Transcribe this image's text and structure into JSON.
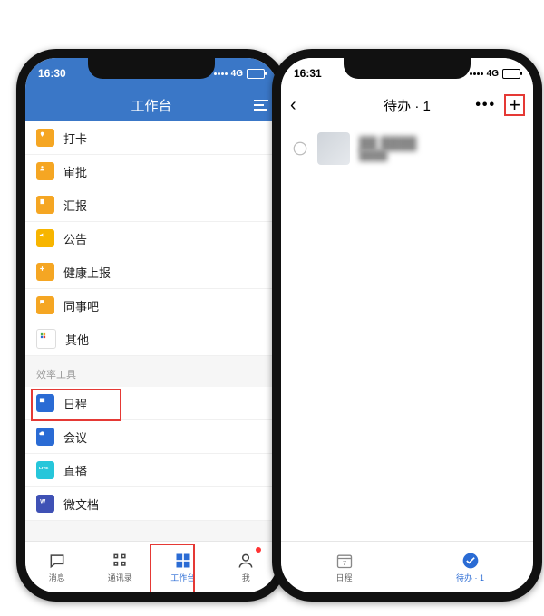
{
  "leftPhone": {
    "status": {
      "time": "16:30",
      "net": "4G"
    },
    "nav": {
      "title": "工作台"
    },
    "apps": [
      {
        "label": "打卡",
        "icon": "pin-icon",
        "color": "c-orange"
      },
      {
        "label": "审批",
        "icon": "person-icon",
        "color": "c-orange"
      },
      {
        "label": "汇报",
        "icon": "report-icon",
        "color": "c-orange"
      },
      {
        "label": "公告",
        "icon": "announce-icon",
        "color": "c-yellow"
      },
      {
        "label": "健康上报",
        "icon": "health-icon",
        "color": "c-orange"
      },
      {
        "label": "同事吧",
        "icon": "chat-icon",
        "color": "c-orange"
      },
      {
        "label": "其他",
        "icon": "grid-icon",
        "color": "c-blue"
      }
    ],
    "sectionTitle": "效率工具",
    "tools": [
      {
        "label": "日程",
        "icon": "calendar-icon",
        "color": "c-blue",
        "highlight": true
      },
      {
        "label": "会议",
        "icon": "cloud-icon",
        "color": "c-blue"
      },
      {
        "label": "直播",
        "icon": "live-icon",
        "color": "c-cyan"
      },
      {
        "label": "微文档",
        "icon": "docs-icon",
        "color": "c-indigo"
      }
    ],
    "tabs": [
      {
        "label": "消息",
        "name": "tab-messages"
      },
      {
        "label": "通讯录",
        "name": "tab-contacts"
      },
      {
        "label": "工作台",
        "name": "tab-workspace",
        "active": true,
        "highlight": true
      },
      {
        "label": "我",
        "name": "tab-me",
        "badge": true
      }
    ]
  },
  "rightPhone": {
    "status": {
      "time": "16:31",
      "net": "4G"
    },
    "nav": {
      "title": "待办 · 1"
    },
    "todoItem": {
      "title": "██ ████",
      "subtitle": "████"
    },
    "tabs": [
      {
        "label": "日程",
        "name": "tab-calendar"
      },
      {
        "label": "待办 · 1",
        "name": "tab-todo",
        "active": true
      }
    ]
  }
}
